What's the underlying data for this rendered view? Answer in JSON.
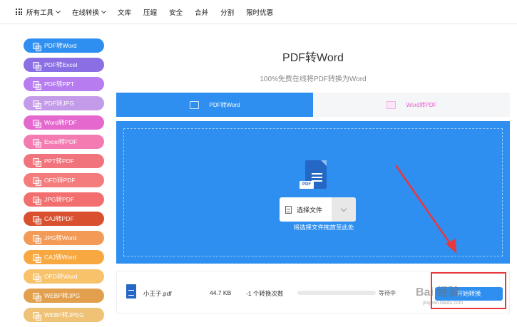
{
  "topnav": {
    "items": [
      {
        "label": "所有工具",
        "has_dropdown": true
      },
      {
        "label": "在线转换",
        "has_dropdown": true
      },
      {
        "label": "文库",
        "has_dropdown": false
      },
      {
        "label": "压缩",
        "has_dropdown": false
      },
      {
        "label": "安全",
        "has_dropdown": false
      },
      {
        "label": "合并",
        "has_dropdown": false
      },
      {
        "label": "分割",
        "has_dropdown": false
      },
      {
        "label": "限时优惠",
        "has_dropdown": false
      }
    ]
  },
  "sidebar": {
    "items": [
      {
        "label": "PDF转Word",
        "color": "#2e8ff0"
      },
      {
        "label": "PDF转Excel",
        "color": "#8a6ee3"
      },
      {
        "label": "PDF转PPT",
        "color": "#b77df0"
      },
      {
        "label": "PDF转JPG",
        "color": "#c39be8"
      },
      {
        "label": "Word转PDF",
        "color": "#e568cf"
      },
      {
        "label": "Excel转PDF",
        "color": "#f47bb1"
      },
      {
        "label": "PPT转PDF",
        "color": "#f1737c"
      },
      {
        "label": "OFD转PDF",
        "color": "#f47c7c"
      },
      {
        "label": "JPG转PDF",
        "color": "#f36e6e"
      },
      {
        "label": "CAJ转PDF",
        "color": "#d9502f"
      },
      {
        "label": "JPG转Word",
        "color": "#f49a57"
      },
      {
        "label": "CAJ转Word",
        "color": "#f7a840"
      },
      {
        "label": "OFD转Word",
        "color": "#f7c26a"
      },
      {
        "label": "WEBP转JPG",
        "color": "#e2a04e"
      },
      {
        "label": "WEBP转JPEG",
        "color": "#efc275"
      }
    ]
  },
  "main": {
    "title": "PDF转Word",
    "subtitle": "100%免费在线将PDF转换为Word",
    "tabs": [
      {
        "label": "PDF转Word",
        "active": true
      },
      {
        "label": "Word转PDF",
        "active": false
      }
    ],
    "upload": {
      "badge": "PDF",
      "select_label": "选择文件",
      "drop_hint": "将选择文件拖放至此处"
    },
    "file_row": {
      "name": "小王子.pdf",
      "size": "44.7 KB",
      "count": "-1 个转换次数",
      "progress": 0,
      "status": "等待中",
      "button_label": "开始转换"
    }
  },
  "overlay": {
    "watermark": "Bai 经验",
    "watermark_url": "jingyan.baidu.com",
    "annotation_color": "#e8383d"
  }
}
